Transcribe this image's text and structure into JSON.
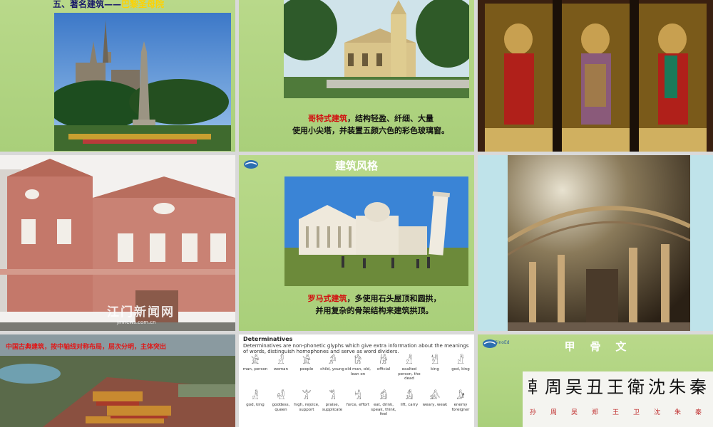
{
  "tile1": {
    "heading": "五、著名建筑——",
    "heading_highlight": "巴黎圣母院"
  },
  "tile2": {
    "caption_highlight": "哥特式建筑",
    "caption_line1": "，结构轻盈、纤细、大量",
    "caption_line2": "使用小尖塔，并装置五颜六色的彩色玻璃窗。"
  },
  "tile4": {
    "watermark_cn": "江门新闻网",
    "watermark_url": "jmnews.com.cn"
  },
  "tile5": {
    "title": "建筑风格",
    "caption_highlight": "罗马式建筑",
    "caption_line1": "，多使用石头屋顶和圆拱，",
    "caption_line2": "并用复杂的骨架结构来建筑拱顶。"
  },
  "tile7": {
    "caption": "中国古典建筑，按中轴线对称布局，层次分明，主体突出"
  },
  "tile8": {
    "title": "Determinatives",
    "description": "Determinatives are non-phonetic glyphs which give extra information about the meanings of words, distinguish homophones and serve as word dividers.",
    "glyphs": [
      {
        "sym": "𓀀",
        "label": "man, person"
      },
      {
        "sym": "𓁐",
        "label": "woman"
      },
      {
        "sym": "𓀀",
        "label": "people"
      },
      {
        "sym": "𓀔",
        "label": "child, young"
      },
      {
        "sym": "𓀗",
        "label": "old man, old, lean on"
      },
      {
        "sym": "𓀙",
        "label": "official"
      },
      {
        "sym": "𓀭",
        "label": "exalted person, the dead"
      },
      {
        "sym": "𓀮",
        "label": "king"
      },
      {
        "sym": "𓀯",
        "label": "god, king"
      },
      {
        "sym": "𓁚",
        "label": "god, king"
      },
      {
        "sym": "𓁗",
        "label": "goddess, queen"
      },
      {
        "sym": "𓀠",
        "label": "high, rejoice, support"
      },
      {
        "sym": "𓀢",
        "label": "praise, supplicate"
      },
      {
        "sym": "𓀜",
        "label": "force, effort"
      },
      {
        "sym": "𓀁",
        "label": "eat, drink, speak, think, feel"
      },
      {
        "sym": "𓀋",
        "label": "lift, carry"
      },
      {
        "sym": "𓀉",
        "label": "weary, weak"
      },
      {
        "sym": "𓀏",
        "label": "enemy foreigner"
      }
    ]
  },
  "tile9": {
    "logo_text": "SinoEd",
    "title": "甲    骨    文",
    "glyphs": [
      "𠦝",
      "周",
      "吴",
      "丑",
      "王",
      "衛",
      "沈",
      "朱",
      "秦"
    ],
    "names": [
      "孙",
      "周",
      "吴",
      "郑",
      "王",
      "卫",
      "沈",
      "朱",
      "秦"
    ]
  },
  "colors": {
    "slide_green": "#b0d37f",
    "highlight_red": "#d21010",
    "heading_yellow": "#ffd200"
  }
}
